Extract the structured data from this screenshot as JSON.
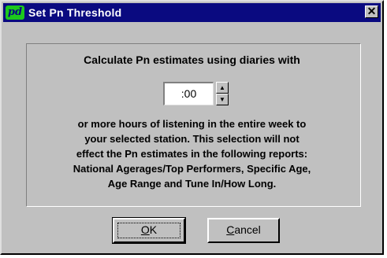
{
  "window": {
    "title": "Set Pn Threshold",
    "app_icon_text": "pd",
    "close_glyph": "✕"
  },
  "dialog": {
    "prompt": "Calculate Pn estimates using diaries with",
    "spinner": {
      "value": ":00",
      "up_glyph": "▲",
      "down_glyph": "▼"
    },
    "description_lines": [
      "or more hours of listening in the entire week to",
      "your selected station.  This selection will not",
      "effect the Pn estimates in the following reports:",
      "National Agerages/Top Performers, Specific Age,",
      "Age Range and Tune In/How Long."
    ]
  },
  "buttons": {
    "ok": {
      "mnemonic": "O",
      "rest": "K"
    },
    "cancel": {
      "mnemonic": "C",
      "rest": "ancel"
    }
  },
  "colors": {
    "titlebar": "#0a0a80",
    "face": "#c0c0c0",
    "icon": "#1cc81c"
  }
}
